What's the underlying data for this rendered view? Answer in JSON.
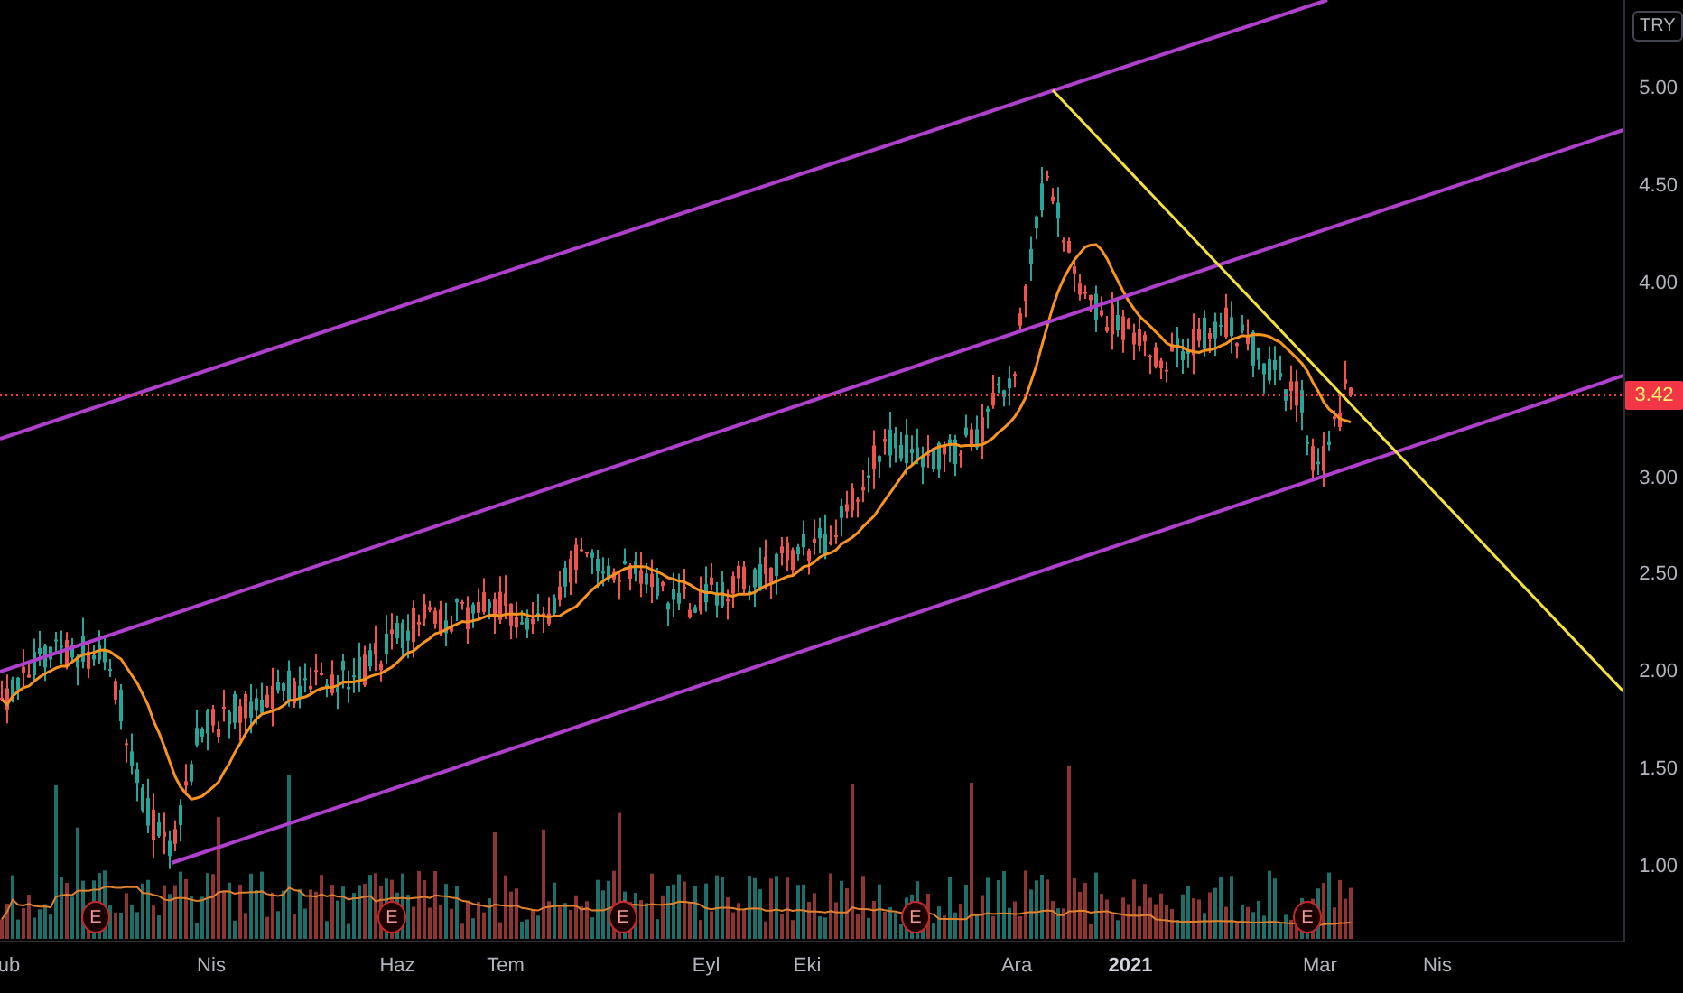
{
  "price_axis": {
    "currency": "TRY",
    "ticks": [
      "5.00",
      "4.50",
      "4.00",
      "3.00",
      "2.50",
      "2.00",
      "1.50",
      "1.00"
    ],
    "last_price": "3.42"
  },
  "time_axis": {
    "labels": [
      "ub",
      "Nis",
      "Haz",
      "Tem",
      "Eyl",
      "Eki",
      "Ara",
      "2021",
      "Mar",
      "Nis"
    ]
  },
  "events": [
    "E",
    "E",
    "E",
    "E",
    "E"
  ]
}
